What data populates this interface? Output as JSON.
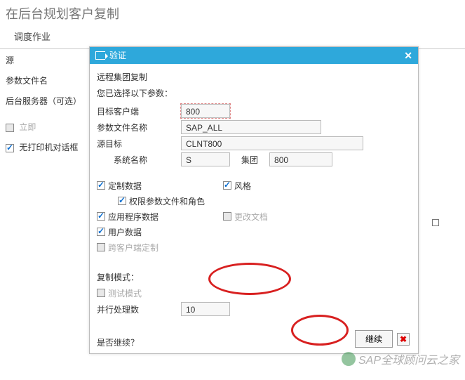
{
  "page": {
    "title": "在后台规划客户复制",
    "menu_item": "调度作业"
  },
  "left": {
    "source": "源",
    "param_file": "参数文件名",
    "bg_server": "后台服务器（可选）",
    "immediate": "立即",
    "no_printer_dialog": "无打印机对话框"
  },
  "dialog": {
    "title": "验证",
    "heading": "远程集团复制",
    "selected_params": "您已选择以下参数：",
    "fields": {
      "target_client_label": "目标客户端",
      "target_client_value": "800",
      "param_file_label": "参数文件名称",
      "param_file_value": "SAP_ALL",
      "source_target_label": "源目标",
      "source_target_value": "CLNT800",
      "system_name_label": "系统名称",
      "system_name_value": "S",
      "group_label": "集团",
      "group_value": "800"
    },
    "checks": {
      "custom_data": "定制数据",
      "style": "风格",
      "auth_param_roles": "权限参数文件和角色",
      "app_program_data": "应用程序数据",
      "change_doc": "更改文档",
      "user_data": "用户数据",
      "cross_client": "跨客户端定制"
    },
    "copy_mode": {
      "label": "复制模式：",
      "test_mode": "测试模式",
      "parallel_label": "并行处理数",
      "parallel_value": "10"
    },
    "confirm_label": "是否继续？",
    "continue_btn": "继续"
  },
  "watermark": "SAP全球顾问云之家"
}
